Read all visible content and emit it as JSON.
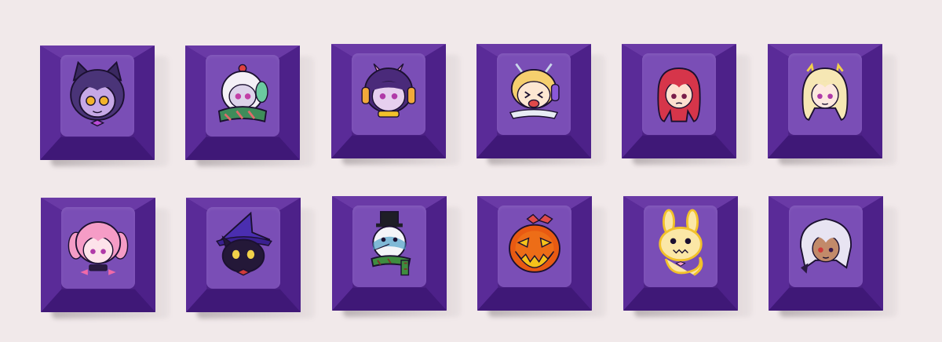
{
  "image": {
    "background_color": "#f1e9ea",
    "keycap_color": "#4c2185",
    "keycap_face_color": "#7a4eb6"
  },
  "keycaps": [
    {
      "row": 1,
      "col": 1,
      "icon": "purple-cat-girl-icon"
    },
    {
      "row": 1,
      "col": 2,
      "icon": "white-robot-scarf-icon"
    },
    {
      "row": 1,
      "col": 3,
      "icon": "headphone-girl-icon"
    },
    {
      "row": 1,
      "col": 4,
      "icon": "blonde-boy-headphones-icon"
    },
    {
      "row": 1,
      "col": 5,
      "icon": "red-hair-girl-icon"
    },
    {
      "row": 1,
      "col": 6,
      "icon": "blonde-girl-icon"
    },
    {
      "row": 2,
      "col": 1,
      "icon": "pink-twintail-girl-icon"
    },
    {
      "row": 2,
      "col": 2,
      "icon": "witch-cat-icon"
    },
    {
      "row": 2,
      "col": 3,
      "icon": "snowman-icon"
    },
    {
      "row": 2,
      "col": 4,
      "icon": "jack-o-lantern-icon"
    },
    {
      "row": 2,
      "col": 5,
      "icon": "yellow-ghost-bunny-icon"
    },
    {
      "row": 2,
      "col": 6,
      "icon": "silver-hair-girl-icon"
    }
  ]
}
